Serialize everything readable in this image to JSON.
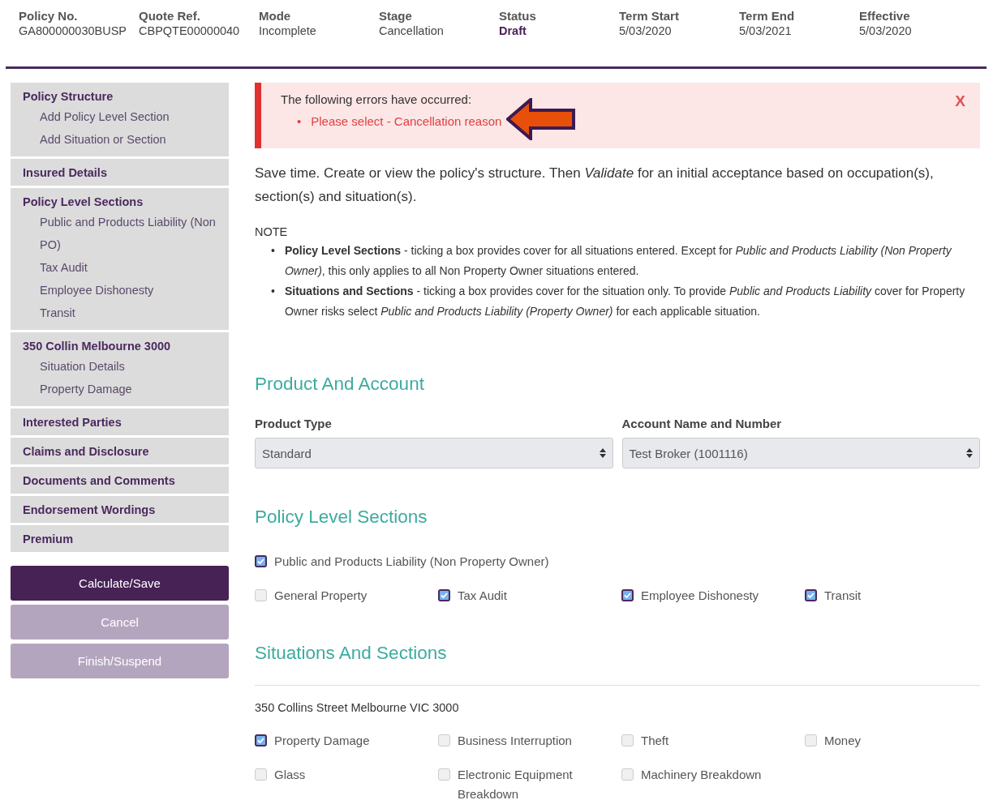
{
  "header": [
    {
      "label": "Policy No.",
      "value": "GA800000030BUSP",
      "highlighted": false
    },
    {
      "label": "Quote Ref.",
      "value": "CBPQTE00000040",
      "highlighted": false
    },
    {
      "label": "Mode",
      "value": "Incomplete",
      "highlighted": false
    },
    {
      "label": "Stage",
      "value": "Cancellation",
      "highlighted": false
    },
    {
      "label": "Status",
      "value": "Draft",
      "highlighted": true
    },
    {
      "label": "Term Start",
      "value": "5/03/2020",
      "highlighted": false
    },
    {
      "label": "Term End",
      "value": "5/03/2021",
      "highlighted": false
    },
    {
      "label": "Effective",
      "value": "5/03/2020",
      "highlighted": false
    }
  ],
  "sidebar": {
    "groups": [
      {
        "title": "Policy Structure",
        "children": [
          "Add Policy Level Section",
          "Add Situation or Section"
        ]
      },
      {
        "title": "Insured Details"
      },
      {
        "title": "Policy Level Sections",
        "children": [
          "Public and Products Liability (Non PO)",
          "Tax Audit",
          "Employee Dishonesty",
          "Transit"
        ]
      },
      {
        "title": "350 Collin Melbourne 3000",
        "children": [
          "Situation Details",
          "Property Damage"
        ]
      },
      {
        "title": "Interested Parties"
      },
      {
        "title": "Claims and Disclosure"
      },
      {
        "title": "Documents and Comments"
      },
      {
        "title": "Endorsement Wordings"
      },
      {
        "title": "Premium"
      }
    ],
    "buttons": [
      {
        "label": "Calculate/Save",
        "disabled": false
      },
      {
        "label": "Cancel",
        "disabled": true
      },
      {
        "label": "Finish/Suspend",
        "disabled": true
      }
    ]
  },
  "error": {
    "title": "The following errors have occurred:",
    "bullet": "•",
    "items": [
      "Please select - Cancellation reason"
    ],
    "close": "X"
  },
  "intro": "Save time. Create or view the policy's structure. Then *Validate* for an initial acceptance based on occupation(s), section(s) and situation(s).",
  "note": {
    "label": "NOTE",
    "bullet": "•",
    "items": [
      "**Policy Level Sections** - ticking a box provides cover for all situations entered. Except for *Public and Products Liability (Non Property Owner)*, this only applies to all Non Property Owner situations entered.",
      "**Situations and Sections** - ticking a box provides cover for the situation only. To provide *Public and Products Liability* cover for Property Owner risks select *Public and Products Liability (Property Owner)* for each applicable situation."
    ]
  },
  "product": {
    "title": "Product And Account",
    "fields": [
      {
        "label": "Product Type",
        "value": "Standard"
      },
      {
        "label": "Account Name and Number",
        "value": "Test Broker (1001116)"
      }
    ]
  },
  "policy_sections": {
    "title": "Policy Level Sections",
    "rows": [
      [
        {
          "label": "Public and Products Liability (Non Property Owner)",
          "checked": true
        }
      ],
      [
        {
          "label": "General Property",
          "checked": false
        },
        {
          "label": "Tax Audit",
          "checked": true
        },
        {
          "label": "Employee Dishonesty",
          "checked": true
        },
        {
          "label": "Transit",
          "checked": true
        }
      ]
    ]
  },
  "situations": {
    "title": "Situations And Sections",
    "address": "350 Collins Street Melbourne VIC 3000",
    "rows": [
      [
        {
          "label": "Property Damage",
          "checked": true
        },
        {
          "label": "Business Interruption",
          "checked": false
        },
        {
          "label": "Theft",
          "checked": false
        },
        {
          "label": "Money",
          "checked": false
        }
      ],
      [
        {
          "label": "Glass",
          "checked": false
        },
        {
          "label": "Electronic Equipment Breakdown",
          "checked": false
        },
        {
          "label": "Machinery Breakdown",
          "checked": false
        }
      ]
    ]
  }
}
